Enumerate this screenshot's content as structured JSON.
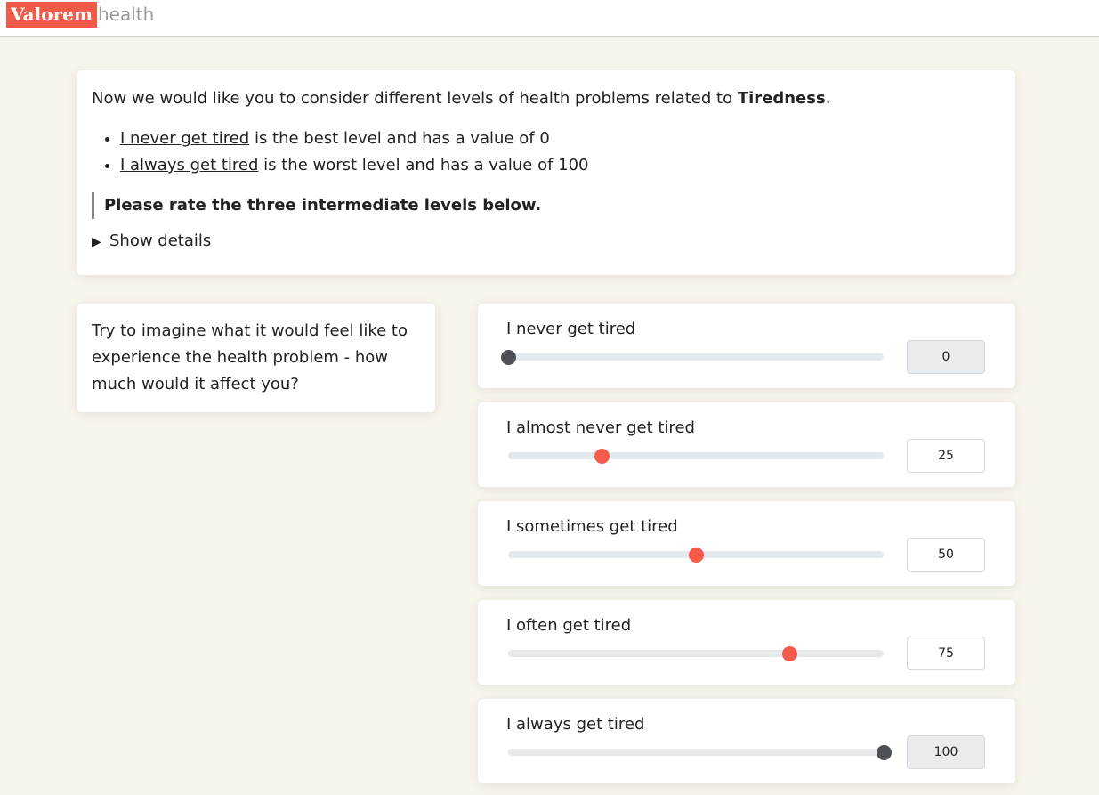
{
  "brand": {
    "logo_main": "Valorem",
    "logo_suffix": "health",
    "accent": "#f05a46"
  },
  "intro": {
    "lead_prefix": "Now we would like you to consider different levels of health problems related to ",
    "lead_topic": "Tiredness",
    "lead_suffix": ".",
    "bullets": [
      {
        "link": "I never get tired",
        "text": " is the best level and has a value of 0"
      },
      {
        "link": "I always get tired",
        "text": " is the worst level and has a value of 100"
      }
    ],
    "instruction": "Please rate the three intermediate levels below.",
    "details_label": "Show details",
    "details_icon": "triangle-right-icon"
  },
  "imagine_text": "Try to imagine what it would feel like to experience the health problem - how much would it affect you?",
  "sliders": [
    {
      "label": "I never get tired",
      "value": "0",
      "fraction": 0.0,
      "locked": true
    },
    {
      "label": "I almost never get tired",
      "value": "25",
      "fraction": 0.25,
      "locked": false
    },
    {
      "label": "I sometimes get tired",
      "value": "50",
      "fraction": 0.5,
      "locked": false
    },
    {
      "label": "I often get tired",
      "value": "75",
      "fraction": 0.75,
      "locked": false
    },
    {
      "label": "I always get tired",
      "value": "100",
      "fraction": 1.0,
      "locked": true
    }
  ]
}
